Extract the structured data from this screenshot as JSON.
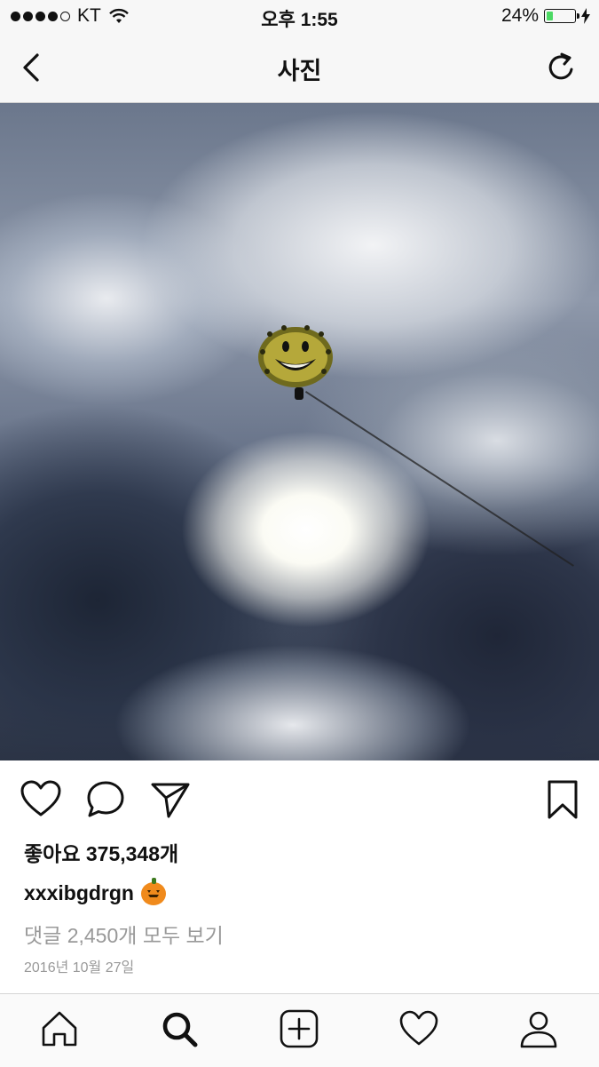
{
  "status_bar": {
    "carrier": "KT",
    "time": "오후 1:55",
    "battery_percent": "24%",
    "battery_level": 0.24,
    "battery_color": "#4cd964"
  },
  "nav": {
    "title": "사진",
    "back_icon": "chevron-left-icon",
    "refresh_icon": "refresh-icon"
  },
  "post": {
    "actions": [
      "heart-icon",
      "comment-icon",
      "share-icon",
      "bookmark-icon"
    ],
    "likes_text": "좋아요 375,348개",
    "username": "xxxibgdrgn",
    "caption_emoji": "pumpkin-emoji",
    "comments_link": "댓글 2,450개 모두 보기",
    "date": "2016년 10월 27일"
  },
  "tab_bar": {
    "items": [
      "home-icon",
      "search-icon",
      "add-post-icon",
      "activity-heart-icon",
      "profile-icon"
    ],
    "active": "search-icon"
  }
}
